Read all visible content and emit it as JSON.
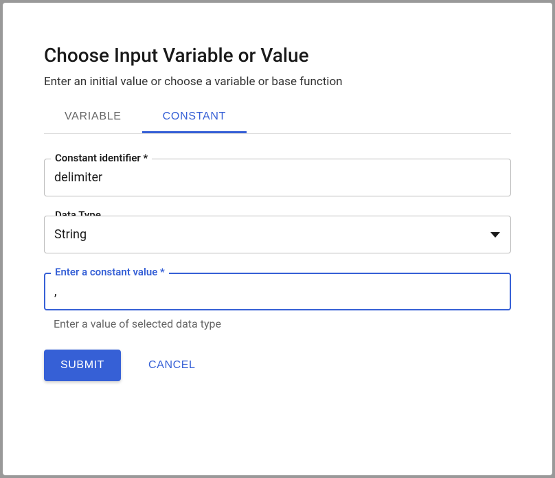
{
  "dialog": {
    "title": "Choose Input Variable or Value",
    "subtitle": "Enter an initial value or choose a variable or base function"
  },
  "tabs": {
    "variable": "Variable",
    "constant": "Constant"
  },
  "fields": {
    "identifier": {
      "label": "Constant identifier *",
      "value": "delimiter"
    },
    "dataType": {
      "label": "Data Type",
      "value": "String"
    },
    "constantValue": {
      "label": "Enter a constant value *",
      "value": ",",
      "helper": "Enter a value of selected data type"
    }
  },
  "actions": {
    "submit": "Submit",
    "cancel": "Cancel"
  }
}
